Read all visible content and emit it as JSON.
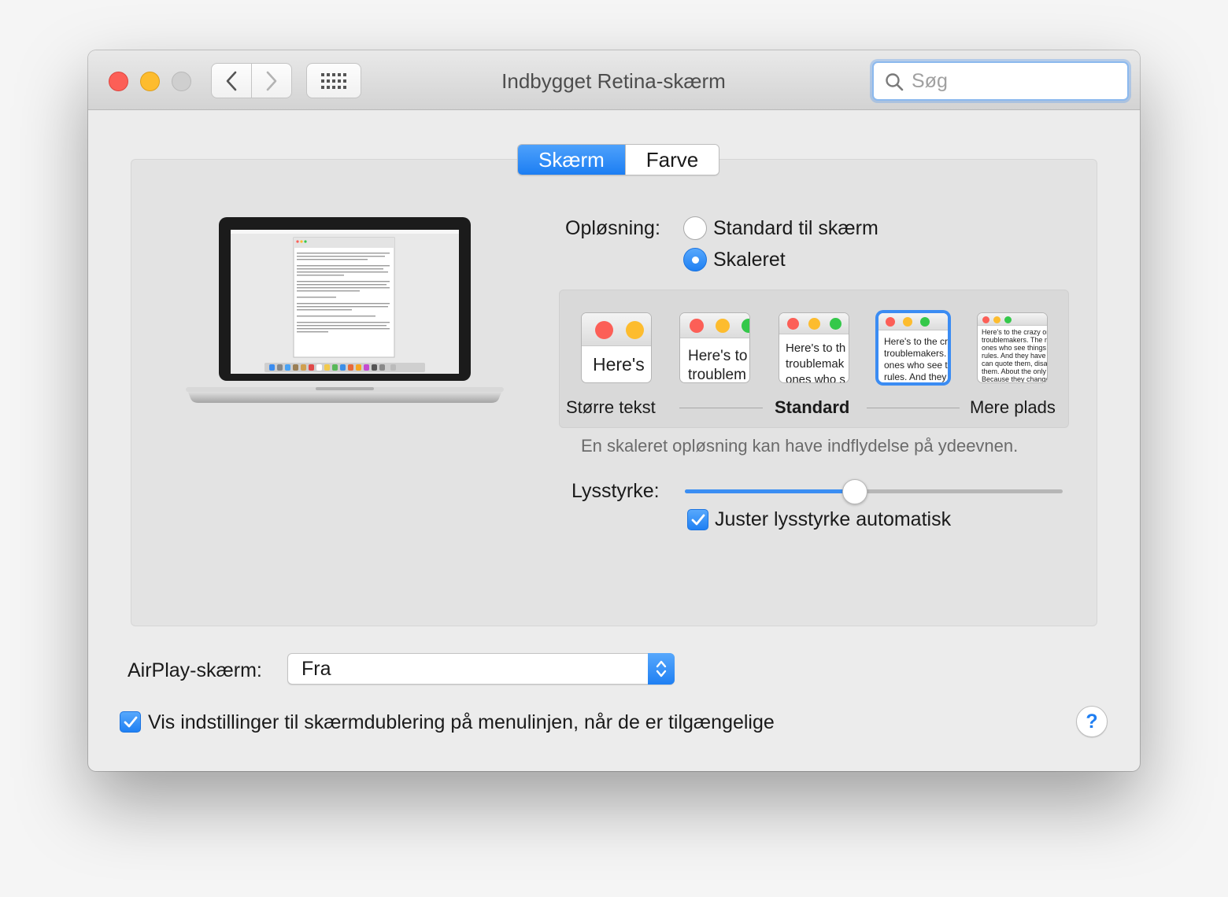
{
  "window": {
    "title": "Indbygget Retina-skærm"
  },
  "toolbar": {
    "search_placeholder": "Søg"
  },
  "tabs": [
    {
      "label": "Skærm",
      "active": true
    },
    {
      "label": "Farve",
      "active": false
    }
  ],
  "resolution": {
    "label": "Opløsning:",
    "options": [
      {
        "label": "Standard til skærm",
        "selected": false
      },
      {
        "label": "Skaleret",
        "selected": true
      }
    ],
    "scale_labels": {
      "left": "Større tekst",
      "middle": "Standard",
      "right": "Mere plads"
    },
    "selected_scale": 4,
    "previews": [
      "Here's",
      "Here's to\ntroublem",
      "Here's to th\ntroublemak\nones who s",
      "Here's to the cr\ntroublemakers.\nones who see t\nrules. And they",
      "Here's to the crazy one\ntroublemakers. The rou\nones who see things di\nrules. And they have no\ncan quote them, disagre\nthem. About the only th\nBecause they change th"
    ],
    "hint": "En skaleret opløsning kan have indflydelse på ydeevnen."
  },
  "brightness": {
    "label": "Lysstyrke:",
    "value": 0.45,
    "auto_label": "Juster lysstyrke automatisk",
    "auto_checked": true
  },
  "airplay": {
    "label": "AirPlay-skærm:",
    "value": "Fra"
  },
  "mirroring": {
    "label": "Vis indstillinger til skærmdublering på menulinjen, når de er tilgængelige",
    "checked": true
  },
  "help": {
    "label": "?"
  },
  "colors": {
    "accent": "#1f80f3",
    "close": "#fc5f57",
    "minimize": "#fdbc2e",
    "maximize_disabled": "#cfcfcf"
  }
}
